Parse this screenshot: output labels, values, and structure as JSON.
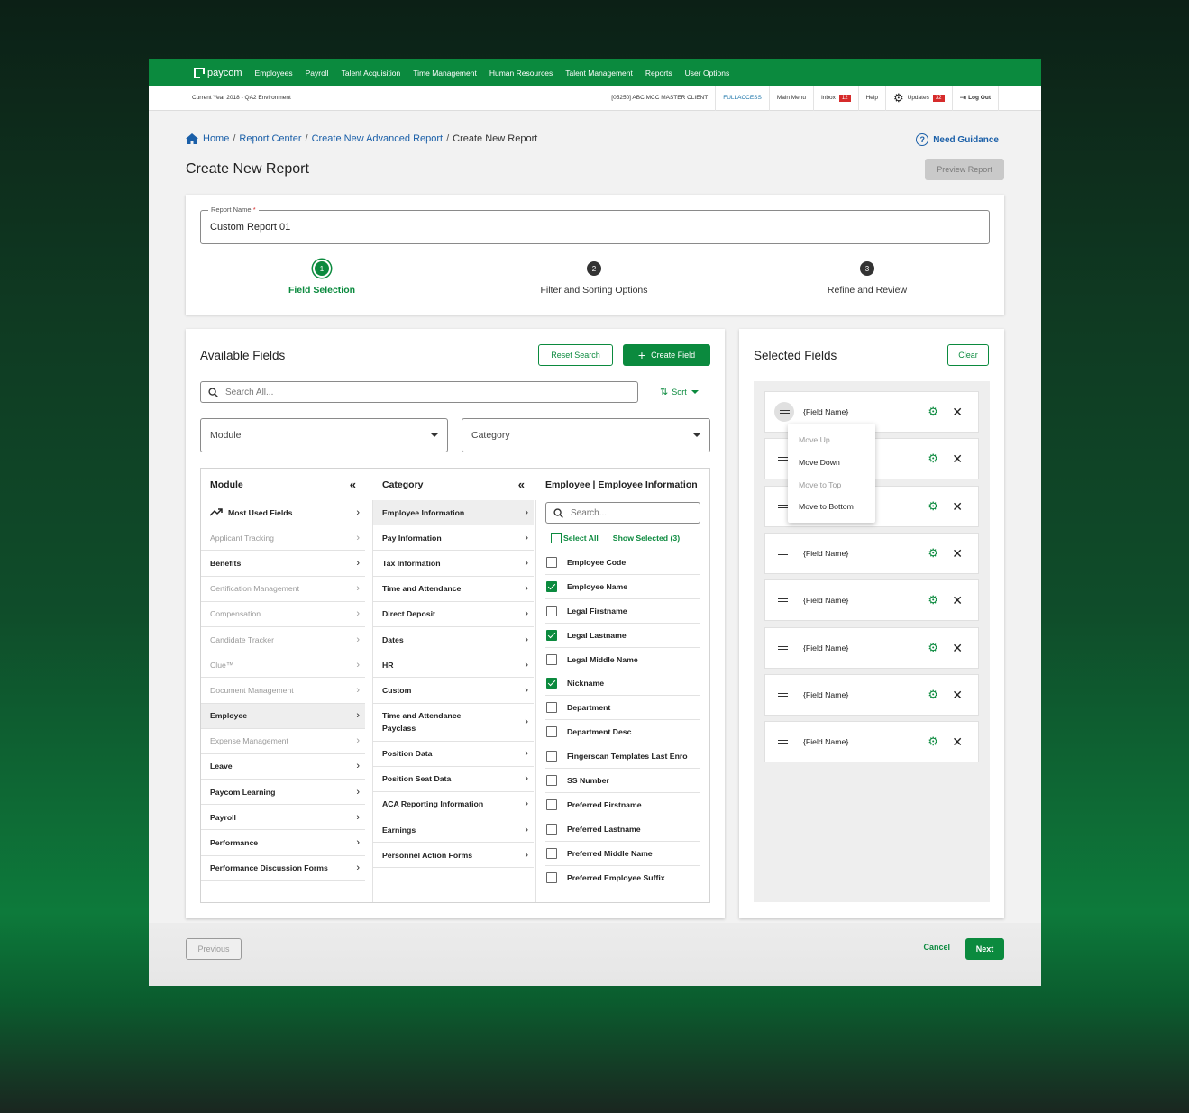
{
  "topnav": {
    "logo": "paycom",
    "items": [
      "Employees",
      "Payroll",
      "Talent Acquisition",
      "Time Management",
      "Human Resources",
      "Talent Management",
      "Reports",
      "User Options"
    ]
  },
  "utilbar": {
    "environment": "Current Year 2018 - QA2 Environment",
    "client": "[05250] ABC MCC MASTER CLIENT",
    "access": "FULLACCESS",
    "main_menu": "Main Menu",
    "inbox": "Inbox",
    "inbox_count": "12",
    "help": "Help",
    "updates": "Updates",
    "updates_count": "32",
    "logout": "Log Out"
  },
  "breadcrumb": [
    "Home",
    "Report Center",
    "Create New Advanced Report",
    "Create New Report"
  ],
  "guidance": "Need Guidance",
  "page_title": "Create New Report",
  "preview_button": "Preview Report",
  "report_name": {
    "label": "Report Name",
    "required": "*",
    "value": "Custom Report 01"
  },
  "steps": [
    {
      "num": "1",
      "label": "Field Selection"
    },
    {
      "num": "2",
      "label": "Filter and Sorting Options"
    },
    {
      "num": "3",
      "label": "Refine and Review"
    }
  ],
  "available": {
    "title": "Available Fields",
    "reset_button": "Reset Search",
    "create_button": "Create Field",
    "search_placeholder": "Search All...",
    "sort_label": "Sort",
    "module_select": "Module",
    "category_select": "Category",
    "module_col_title": "Module",
    "category_col_title": "Category",
    "fields_col_title": "Employee | Employee Information",
    "fields_search_placeholder": "Search...",
    "select_all": "Select All",
    "show_selected": "Show Selected (3)",
    "modules": [
      "Most Used Fields",
      "Applicant Tracking",
      "Benefits",
      "Certification Management",
      "Compensation",
      "Candidate Tracker",
      "Clue™",
      "Document Management",
      "Employee",
      "Expense Management",
      "Leave",
      "Paycom Learning",
      "Payroll",
      "Performance",
      "Performance Discussion Forms"
    ],
    "categories": [
      "Employee Information",
      "Pay Information",
      "Tax Information",
      "Time and Attendance",
      "Direct Deposit",
      "Dates",
      "HR",
      "Custom",
      "Time and Attendance Payclass",
      "Position Data",
      "Position Seat Data",
      "ACA Reporting Information",
      "Earnings",
      "Personnel Action Forms"
    ],
    "fields": [
      "Employee Code",
      "Employee Name",
      "Legal Firstname",
      "Legal Lastname",
      "Legal Middle Name",
      "Nickname",
      "Department",
      "Department Desc",
      "Fingerscan Templates Last Enro",
      "SS Number",
      "Preferred Firstname",
      "Preferred Lastname",
      "Preferred Middle Name",
      "Preferred Employee Suffix"
    ]
  },
  "selected": {
    "title": "Selected Fields",
    "clear_button": "Clear",
    "item_label": "{Field Name}",
    "menu": [
      "Move Up",
      "Move Down",
      "Move to Top",
      "Move to Bottom"
    ]
  },
  "footer": {
    "previous": "Previous",
    "cancel": "Cancel",
    "next": "Next"
  },
  "colors": {
    "brand": "#0b8a3e",
    "link": "#1a5fa8",
    "badge": "#d62b2b"
  }
}
